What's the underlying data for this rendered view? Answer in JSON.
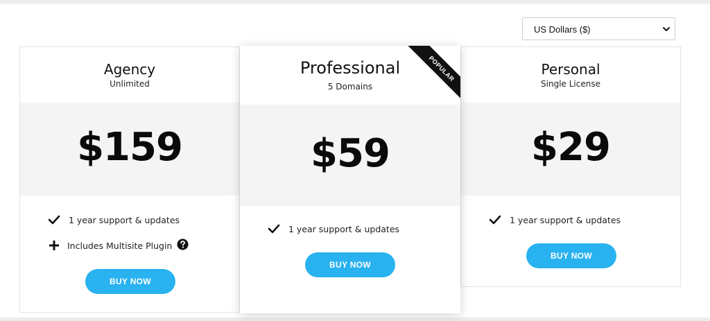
{
  "currency": {
    "selected": "US Dollars ($)"
  },
  "plans": {
    "agency": {
      "name": "Agency",
      "subtitle": "Unlimited",
      "price": "$159",
      "features": [
        "1 year support & updates",
        "Includes Multisite Plugin"
      ],
      "button": "BUY NOW"
    },
    "professional": {
      "name": "Professional",
      "subtitle": "5 Domains",
      "price": "$59",
      "badge": "POPULAR",
      "features": [
        "1 year support & updates"
      ],
      "button": "BUY NOW"
    },
    "personal": {
      "name": "Personal",
      "subtitle": "Single License",
      "price": "$29",
      "features": [
        "1 year support & updates"
      ],
      "button": "BUY NOW"
    }
  },
  "colors": {
    "accent": "#29b2f0",
    "price_band": "#f4f4f4",
    "ribbon": "#111111"
  },
  "icons": {
    "feature_included": "check-icon",
    "feature_addon": "plus-icon",
    "help": "question-circle-icon",
    "select": "chevron-down-icon"
  }
}
